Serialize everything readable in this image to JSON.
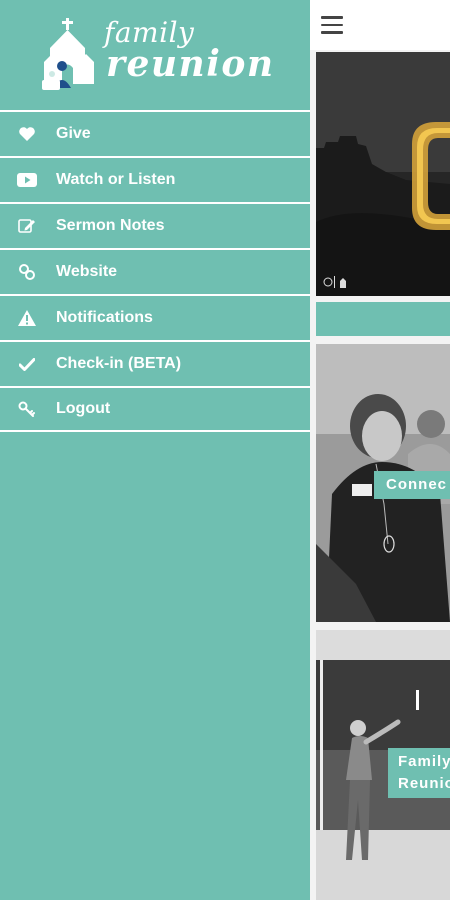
{
  "theme": {
    "teal": "#6fbfb1",
    "white": "#ffffff"
  },
  "brand": {
    "line1": "family",
    "line2": "reunion",
    "logo_icon": "church-family-icon"
  },
  "menu": [
    {
      "label": "Give",
      "icon": "heart-icon"
    },
    {
      "label": "Watch or Listen",
      "icon": "play-video-icon"
    },
    {
      "label": "Sermon Notes",
      "icon": "edit-note-icon"
    },
    {
      "label": "Website",
      "icon": "link-icon"
    },
    {
      "label": "Notifications",
      "icon": "warning-icon"
    },
    {
      "label": "Check-in (BETA)",
      "icon": "checkmark-icon"
    },
    {
      "label": "Logout",
      "icon": "key-icon"
    }
  ],
  "content": {
    "menu_icon": "hamburger-icon",
    "cards": [
      {
        "label_lines": [
          "Connec"
        ]
      },
      {
        "label_lines": [
          "Family",
          "Reunio"
        ]
      }
    ]
  }
}
